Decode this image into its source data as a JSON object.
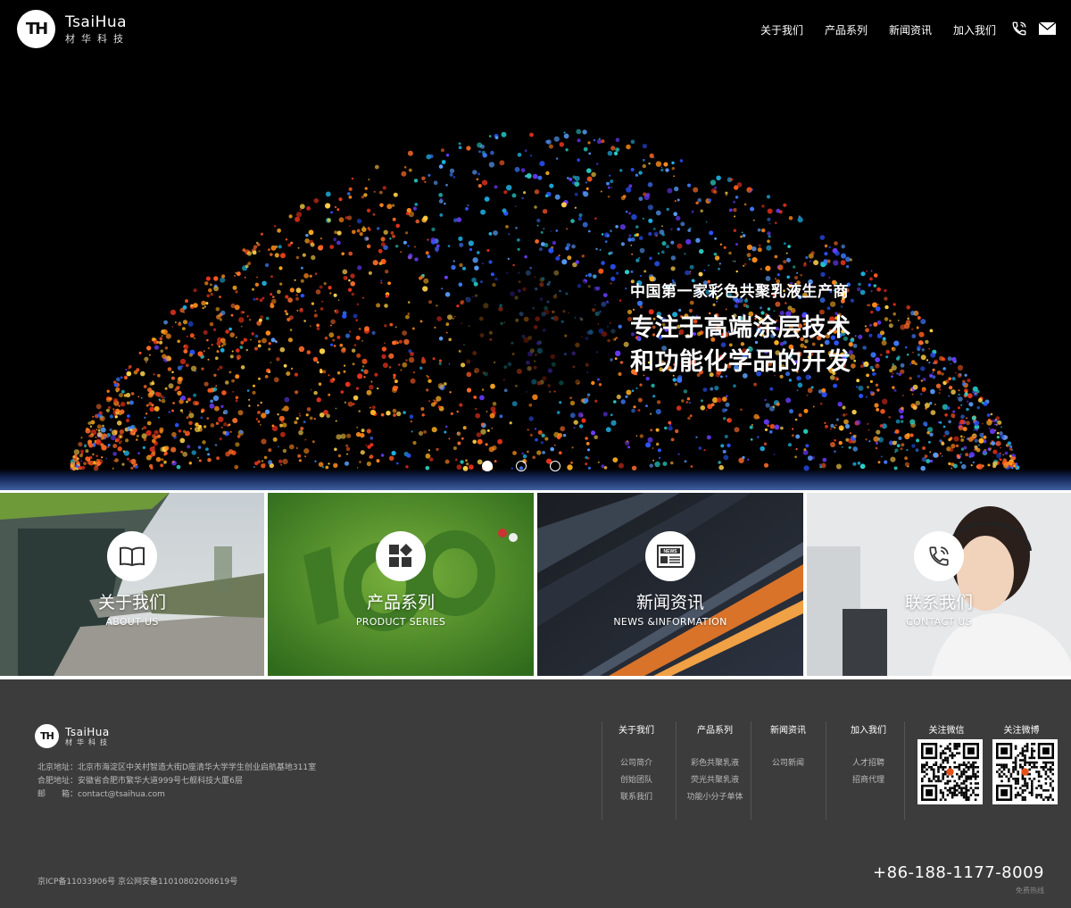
{
  "brand": {
    "initials": "TH",
    "name_en": "TsaiHua",
    "name_cn": "材华科技"
  },
  "nav": {
    "items": [
      "关于我们",
      "产品系列",
      "新闻资讯",
      "加入我们"
    ],
    "phone_icon": "phone-icon",
    "mail_icon": "mail-icon"
  },
  "hero": {
    "tagline": "中国第一家彩色共聚乳液生产商",
    "headline_1": "专注于高端涂层技术",
    "headline_2": "和功能化学品的开发",
    "slides": 3,
    "active_slide": 1
  },
  "tiles": [
    {
      "title": "关于我们",
      "subtitle": "ABOUT US",
      "icon": "book-icon"
    },
    {
      "title": "产品系列",
      "subtitle": "PRODUCT SERIES",
      "icon": "blocks-icon"
    },
    {
      "title": "新闻资讯",
      "subtitle": "NEWS &INFORMATION",
      "icon": "news-icon"
    },
    {
      "title": "联系我们",
      "subtitle": "CONTACT US",
      "icon": "phone-icon"
    }
  ],
  "footer": {
    "address_beijing": "北京地址：北京市海淀区中关村智造大街D座清华大学学生创业启航基地311室",
    "address_hefei": "合肥地址：安徽省合肥市繁华大道999号七舰科技大厦6层",
    "email": "邮　　箱：contact@tsaihua.com",
    "columns": [
      {
        "title": "关于我们",
        "items": [
          "公司简介",
          "创始团队",
          "联系我们"
        ]
      },
      {
        "title": "产品系列",
        "items": [
          "彩色共聚乳液",
          "荧光共聚乳液",
          "功能小分子单体"
        ]
      },
      {
        "title": "新闻资讯",
        "items": [
          "公司新闻"
        ]
      },
      {
        "title": "加入我们",
        "items": [
          "人才招聘",
          "招商代理"
        ]
      }
    ],
    "wechat_label": "关注微信",
    "weibo_label": "关注微博",
    "icp": "京ICP备11033906号 京公网安备11010802008619号",
    "phone": "+86-188-1177-8009",
    "phone_sub": "免费热线"
  }
}
